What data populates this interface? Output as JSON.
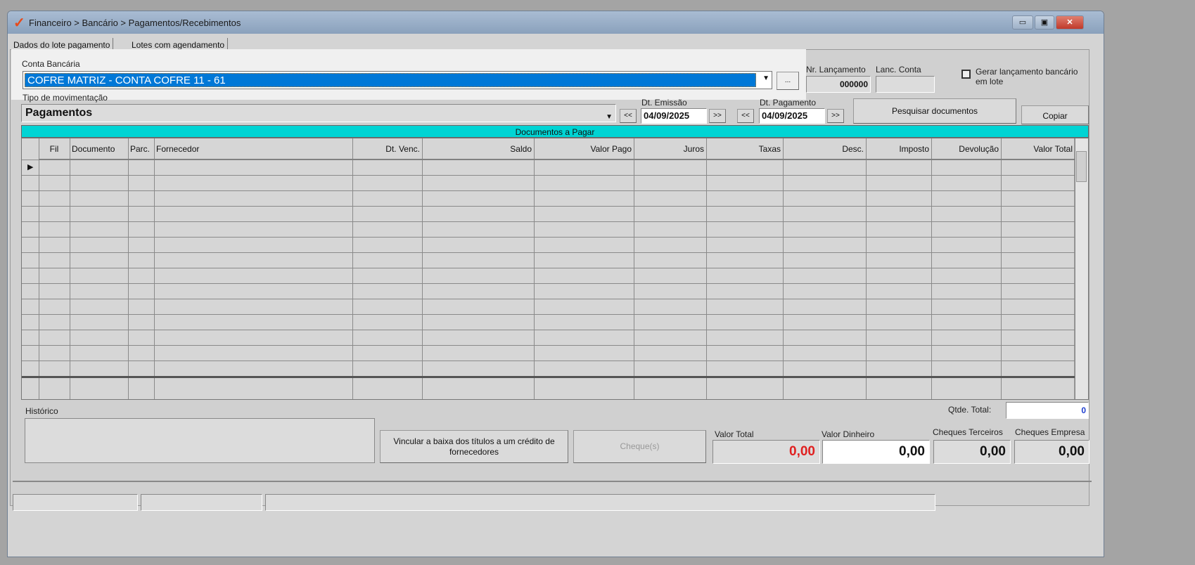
{
  "window": {
    "title": "Financeiro > Bancário > Pagamentos/Recebimentos",
    "minimize": "▭",
    "maximize": "▣",
    "close": "✕"
  },
  "tabs": [
    "Dados do lote pagamento",
    "Lotes com agendamento"
  ],
  "conta": {
    "label": "Conta Bancária",
    "value": "COFRE MATRIZ - CONTA COFRE 11 - 61",
    "more": "..."
  },
  "nr_lancamento": {
    "label": "Nr. Lançamento",
    "value": "000000"
  },
  "lanc_conta": {
    "label": "Lanc. Conta",
    "value": ""
  },
  "gerar": {
    "label": "Gerar lançamento bancário em lote",
    "checked": false
  },
  "tipo": {
    "label": "Tipo de movimentação",
    "value": "Pagamentos"
  },
  "dt_emissao": {
    "label": "Dt. Emissão",
    "value": "04/09/2025",
    "prev": "<<",
    "next": ">>"
  },
  "dt_pagamento": {
    "label": "Dt. Pagamento",
    "value": "04/09/2025",
    "prev": "<<",
    "next": ">>"
  },
  "buttons": {
    "pesquisar": "Pesquisar documentos",
    "copiar": "Copiar",
    "vincular": "Vincular a baixa dos títulos a um crédito de fornecedores",
    "cheques": "Cheque(s)"
  },
  "grid": {
    "title": "Documentos a Pagar",
    "columns": [
      "Fil",
      "Documento",
      "Parc.",
      "Fornecedor",
      "Dt. Venc.",
      "Saldo",
      "Valor Pago",
      "Juros",
      "Taxas",
      "Desc.",
      "Imposto",
      "Devolução",
      "Valor Total"
    ]
  },
  "historico": {
    "label": "Histórico",
    "value": ""
  },
  "qtde_total": {
    "label": "Qtde. Total:",
    "value": "0"
  },
  "totals": {
    "valor_total": {
      "label": "Valor Total",
      "value": "0,00"
    },
    "valor_dinheiro": {
      "label": "Valor Dinheiro",
      "value": "0,00"
    },
    "cheques_terceiros": {
      "label": "Cheques Terceiros",
      "value": "0,00"
    },
    "cheques_empresa": {
      "label": "Cheques Empresa",
      "value": "0,00"
    }
  },
  "colors": {
    "accent": "#0078d7",
    "grid_title": "#00d4d4",
    "negative": "#e02020"
  }
}
